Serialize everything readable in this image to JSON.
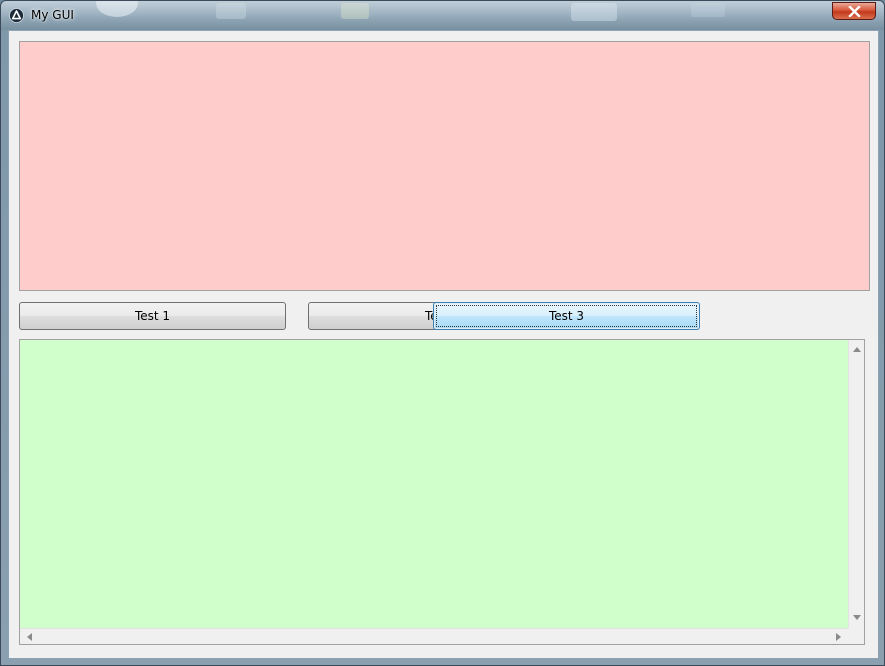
{
  "window": {
    "title": "My GUI",
    "icon": "autoit-icon",
    "close_icon": "close-icon"
  },
  "buttons": {
    "test1": "Test 1",
    "test2": "Test 2",
    "test3": "Test 3"
  },
  "panels": {
    "top_color": "#ffcccc",
    "bottom_color": "#d0ffcc"
  },
  "scrollbar_icons": {
    "up": "scroll-up-arrow-icon",
    "down": "scroll-down-arrow-icon",
    "left": "scroll-left-arrow-icon",
    "right": "scroll-right-arrow-icon"
  }
}
